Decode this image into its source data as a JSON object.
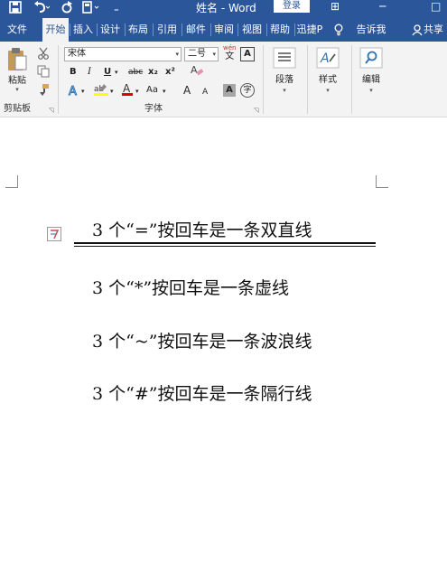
{
  "titlebar": {
    "doc_title": "姓名 - Word",
    "login": "登录",
    "restore_icon": "⊞",
    "minimize_icon": "─",
    "maximize_icon": "□",
    "qa_more": "₌"
  },
  "tabs": {
    "file": "文件",
    "home": "开始",
    "insert": "插入",
    "design": "设计",
    "layout": "布局",
    "references": "引用",
    "mailings": "邮件",
    "review": "审阅",
    "view": "视图",
    "help": "帮助",
    "xunjie": "迅捷P",
    "tellme": "告诉我",
    "share": "共享"
  },
  "ribbon": {
    "paste": "粘贴",
    "clipboard_group": "剪贴板",
    "font_name": "宋体",
    "font_size": "二号",
    "wen": "wén",
    "wen_char": "文",
    "font_group": "字体",
    "bold": "B",
    "italic": "I",
    "underline": "U",
    "strike": "abc",
    "subscript": "x₂",
    "superscript": "x²",
    "font_color_a": "A",
    "highlight": "ab",
    "case_btn": "Aa",
    "grow": "A",
    "shrink": "A",
    "char_shade": "A",
    "enclose": "字",
    "clear_fmt": "A",
    "paragraph": "段落",
    "styles": "样式",
    "editing": "编辑",
    "launcher": "◹"
  },
  "document": {
    "lines": [
      "3 个“=”按回车是一条双直线",
      "3 个“*”按回车是一条虚线",
      "3 个“~”按回车是一条波浪线",
      "3 个“#”按回车是一条隔行线"
    ]
  }
}
